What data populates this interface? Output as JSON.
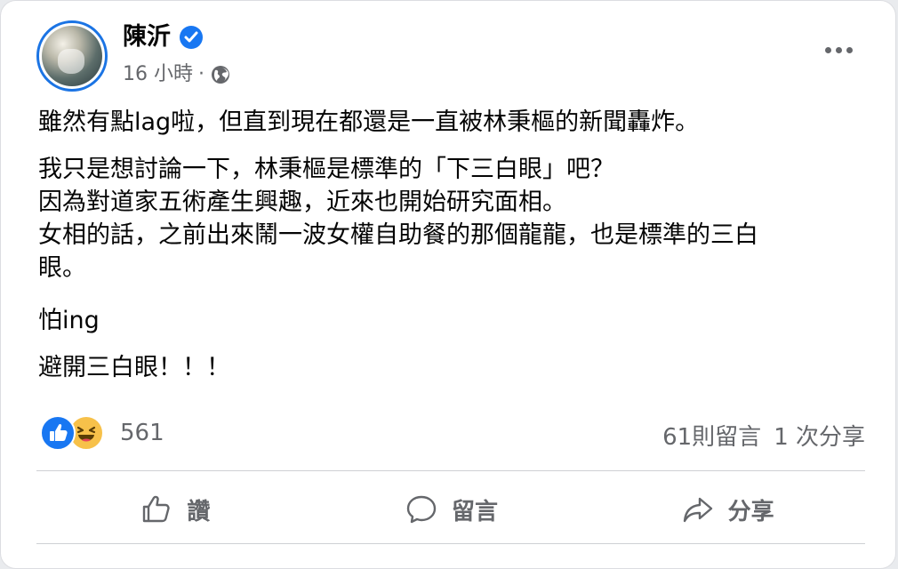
{
  "post": {
    "author": "陳沂",
    "time": "16 小時",
    "meta_sep": "·",
    "icons": {
      "verified": "verified-badge-icon",
      "audience": "globe-icon",
      "menu": "more-options-icon"
    },
    "paragraphs": [
      [
        "雖然有點lag啦，但直到現在都還是一直被林秉樞的新聞轟炸。"
      ],
      [
        "我只是想討論一下，林秉樞是標準的「下三白眼」吧？",
        "因為對道家五術產生興趣，近來也開始研究面相。",
        "女相的話，之前出來鬧一波女權自助餐的那個龍龍，也是標準的三白",
        "眼。"
      ],
      [
        "怕ing"
      ],
      [
        "避開三白眼！！！"
      ]
    ]
  },
  "engagement": {
    "reaction_count": "561",
    "reactions": [
      "like-icon",
      "haha-icon"
    ],
    "comments": "61則留言",
    "shares": "1 次分享"
  },
  "actions": {
    "like_label": "讚",
    "comment_label": "留言",
    "share_label": "分享"
  },
  "colors": {
    "accent": "#1877f2",
    "secondary_text": "#65676b",
    "haha": "#f7c14a"
  }
}
